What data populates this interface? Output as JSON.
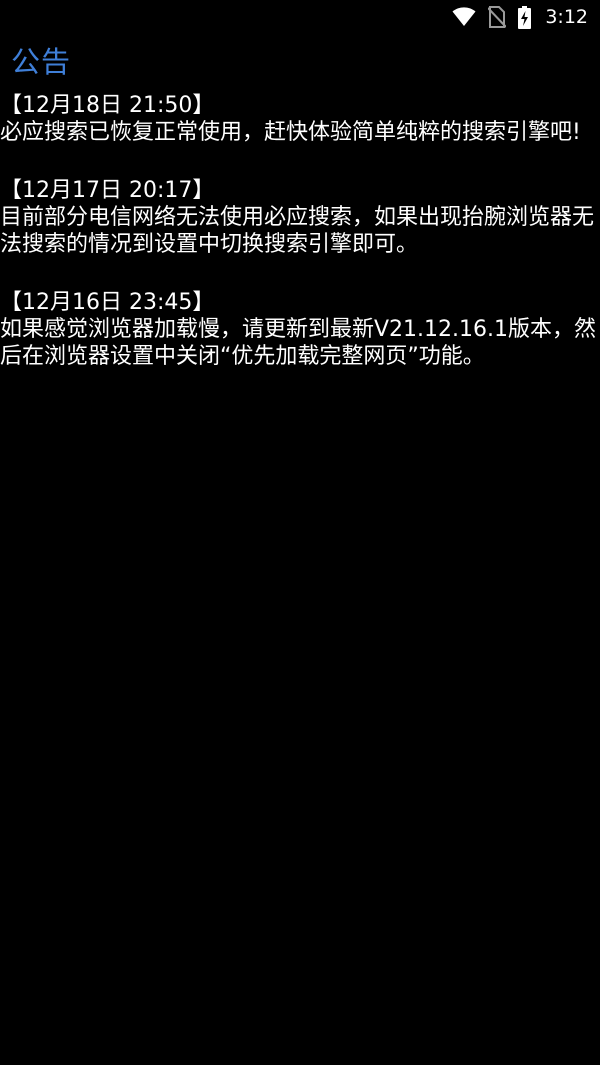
{
  "status_bar": {
    "time": "3:12",
    "icons": [
      "wifi-icon",
      "no-sim-icon",
      "battery-charging-icon"
    ]
  },
  "page": {
    "title": "公告"
  },
  "notices": [
    {
      "date": "【12月18日 21:50】",
      "body": "必应搜索已恢复正常使用，赶快体验简单纯粹的搜索引擎吧!"
    },
    {
      "date": "【12月17日 20:17】",
      "body": "目前部分电信网络无法使用必应搜索，如果出现抬腕浏览器无法搜索的情况到设置中切换搜索引擎即可。"
    },
    {
      "date": "【12月16日 23:45】",
      "body": "如果感觉浏览器加载慢，请更新到最新V21.12.16.1版本，然后在浏览器设置中关闭“优先加载完整网页”功能。"
    }
  ],
  "colors": {
    "background": "#000000",
    "title": "#3f7fd8",
    "text": "#ffffff"
  }
}
